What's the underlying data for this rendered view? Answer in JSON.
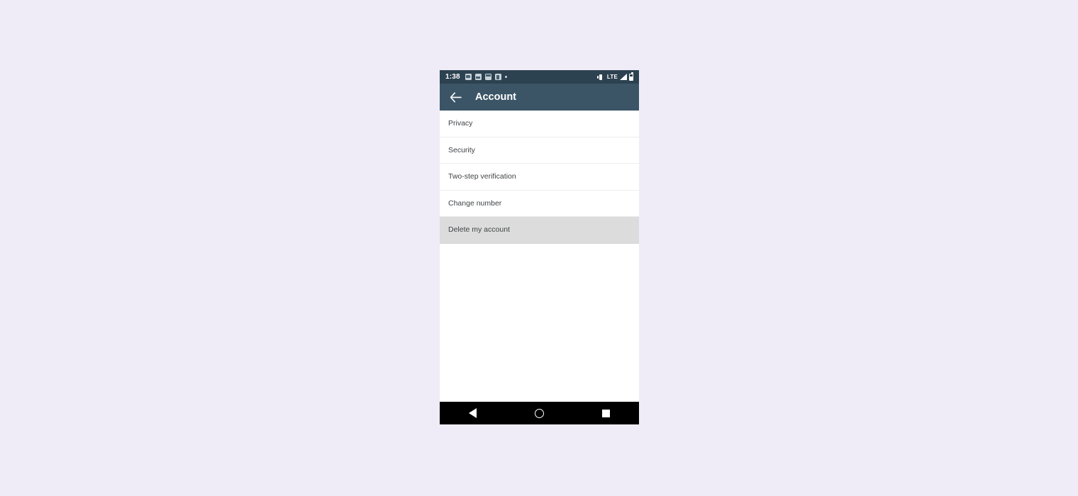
{
  "status_bar": {
    "clock": "1:38",
    "notification_icons": [
      "gallery-icon",
      "window-icon",
      "calendar-icon",
      "sim-card-icon",
      "more-notifications-dot"
    ],
    "vibrate_icon": "vibrate-icon",
    "network_label": "LTE",
    "signal_icon": "signal-bars-icon",
    "battery_icon": "battery-icon",
    "background_color": "#2d4250"
  },
  "app_bar": {
    "back_icon": "back-arrow-icon",
    "title": "Account",
    "background_color": "#3b5567"
  },
  "list": {
    "rows": [
      {
        "label": "Privacy",
        "pressed": false
      },
      {
        "label": "Security",
        "pressed": false
      },
      {
        "label": "Two-step verification",
        "pressed": false
      },
      {
        "label": "Change number",
        "pressed": false
      },
      {
        "label": "Delete my account",
        "pressed": true
      }
    ],
    "pressed_color": "#dcdcdc",
    "divider_color": "#eeeeee",
    "text_color": "#3f4245"
  },
  "nav_bar": {
    "back_label": "Back",
    "home_label": "Home",
    "recents_label": "Recents",
    "background_color": "#000000"
  },
  "page": {
    "background_color": "#efecf7"
  }
}
